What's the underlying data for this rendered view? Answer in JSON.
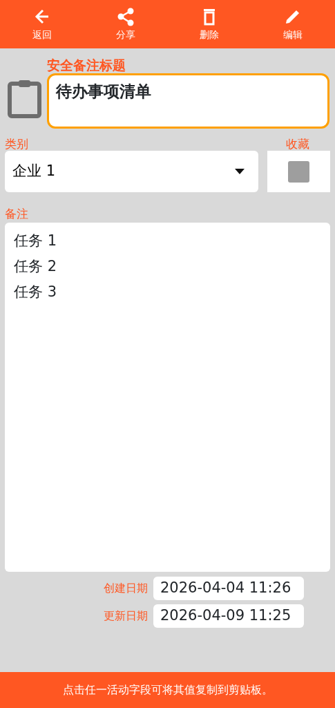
{
  "toolbar": [
    {
      "kind": "back",
      "label": "返回"
    },
    {
      "kind": "share",
      "label": "分享"
    },
    {
      "kind": "delete",
      "label": "删除"
    },
    {
      "kind": "edit",
      "label": "编辑"
    }
  ],
  "title_field": {
    "label": "安全备注标题",
    "value": "待办事项清单"
  },
  "category": {
    "label": "类别",
    "value": "企业 1"
  },
  "favorite": {
    "label": "收藏",
    "checked": false
  },
  "notes": {
    "label": "备注",
    "value": "任务 1\n任务 2\n任务 3"
  },
  "dates": [
    {
      "label": "创建日期",
      "value": "2026-04-04 11:26"
    },
    {
      "label": "更新日期",
      "value": "2026-04-09 11:25"
    }
  ],
  "footer": "点击任一活动字段可将其值复制到剪贴板。"
}
